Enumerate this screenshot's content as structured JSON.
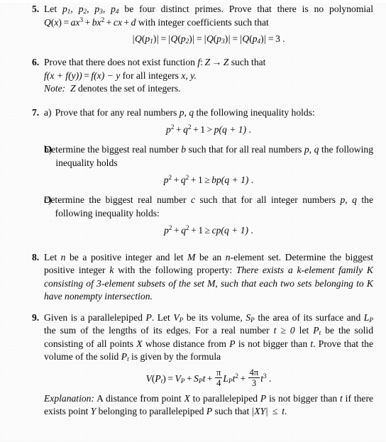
{
  "document": {
    "type": "math-olympiad-problem-sheet",
    "language": "en",
    "problems_shown": [
      "5",
      "6",
      "7",
      "8",
      "9"
    ]
  },
  "problems": [
    {
      "number": "5.",
      "text_before": "Let",
      "statement_part1": " be four distinct primes. Prove that there is no polyno­mial ",
      "statement_part2": " with integer coefficients such that",
      "vars": {
        "p1": "p",
        "p1sub": "1",
        "p2": "p",
        "p2sub": "2",
        "p3": "p",
        "p3sub": "3",
        "p4": "p",
        "p4sub": "4"
      },
      "polynomial": {
        "lhs_fn": "Q",
        "lhs_arg": "x",
        "term1_coef": "a",
        "term1_var": "x",
        "term1_exp": "3",
        "term2_coef": "b",
        "term2_var": "x",
        "term2_exp": "2",
        "term3_coef": "c",
        "term3_var": "x",
        "term4": "d"
      },
      "equation": {
        "value": "3",
        "fn": "Q",
        "args": [
          "p1",
          "p2",
          "p3",
          "p4"
        ]
      }
    },
    {
      "number": "6.",
      "line1": "Prove that there does not exist function ",
      "fn_decl": {
        "name": "f",
        "domain": "Z",
        "codomain": "Z"
      },
      "line1_end": " such that",
      "equation_inline": {
        "lhs": "f(x + f(y))",
        "rhs": "f(x) − y"
      },
      "line2_end": " for all integers ",
      "vars_end": "x, y.",
      "note_label": "Note:",
      "note_text": " denotes the set of integers.",
      "note_symbol": "Z"
    },
    {
      "number": "7.",
      "parts": [
        {
          "label": "a)",
          "text": "Prove that for any real numbers ",
          "vars": "p, q",
          "text_end": " the following inequality holds:",
          "equation": {
            "lhs_terms": [
              "p",
              "q",
              "1"
            ],
            "exponent": "2",
            "relation": ">",
            "rhs": "p(q + 1)",
            "rhs_coef": "",
            "terminator": "."
          }
        },
        {
          "label": "b)",
          "text": "Determine the biggest real number ",
          "var": "b",
          "text_mid": " such that for all real numbers ",
          "vars": "p, q",
          "text_end": " the following inequality holds",
          "equation": {
            "lhs_terms": [
              "p",
              "q",
              "1"
            ],
            "exponent": "2",
            "relation": "≥",
            "rhs_coef": "b",
            "rhs": "p(q + 1)",
            "terminator": "."
          }
        },
        {
          "label": "c)",
          "text": "Determine the biggest real number ",
          "var": "c",
          "text_mid": " such that for all integer numbers ",
          "vars": "p, q",
          "text_end": " the following inequality holds:",
          "equation": {
            "lhs_terms": [
              "p",
              "q",
              "1"
            ],
            "exponent": "2",
            "relation": "≥",
            "rhs_coef": "c",
            "rhs": "p(q + 1)",
            "terminator": "."
          }
        }
      ]
    },
    {
      "number": "8.",
      "text_a": "Let ",
      "var_n": "n",
      "text_b": " be a positive integer and let ",
      "var_M": "M",
      "text_c": " be an ",
      "var_n2": "n",
      "text_d": "-element set. Determine the biggest positive integer ",
      "var_k": "k",
      "text_e": " with the following property: ",
      "italic_property_1": "There exists a ",
      "italic_k": "k",
      "italic_property_2": "-element family ",
      "italic_K": "K",
      "italic_property_3": " consisting of 3-element subsets of the set ",
      "italic_M": "M",
      "italic_property_4": ", such that each two sets belonging to ",
      "italic_K2": "K",
      "italic_property_5": " have nonempty intersection."
    },
    {
      "number": "9.",
      "text_a": "Given is a parallelepiped ",
      "var_P": "P",
      "text_b": ". Let ",
      "var_VP": "V",
      "var_VP_sub": "P",
      "text_c": " be its volume, ",
      "var_SP": "S",
      "var_SP_sub": "P",
      "text_d": " the area of its surface and ",
      "var_LP": "L",
      "var_LP_sub": "P",
      "text_e": " the sum of the lengths of its edges. For a real number ",
      "cond_t": "t ≥ 0",
      "text_f": " let ",
      "var_Pt": "P",
      "var_Pt_sub": "t",
      "text_g": " be the solid consisting of all points ",
      "var_X": "X",
      "text_h": " whose distance from ",
      "var_P2": "P",
      "text_i": " is not bigger than ",
      "var_t": "t",
      "text_j": ". Prove that the volume of the solid ",
      "var_Pt2": "P",
      "var_Pt2_sub": "t",
      "text_k": " is given by the formula",
      "formula": {
        "lhs_fn": "V",
        "lhs_arg": "P",
        "lhs_arg_sub": "t",
        "t1": "V",
        "t1sub": "P",
        "t2": "S",
        "t2sub": "P",
        "t2var": "t",
        "t3_num": "π",
        "t3_den": "4",
        "t3var": "L",
        "t3sub": "P",
        "t3t": "t",
        "t3exp": "2",
        "t4_num": "4π",
        "t4_den": "3",
        "t4t": "t",
        "t4exp": "3",
        "terminator": "."
      },
      "explanation_label": "Explanation:",
      "explanation_a": " A distance from point ",
      "exp_X": "X",
      "explanation_b": " to parallelepiped ",
      "exp_P": "P",
      "explanation_c": " is not bigger than ",
      "exp_t": "t",
      "explanation_d": " if there exists point ",
      "exp_Y": "Y",
      "explanation_e": " belonging to parallelepiped ",
      "exp_P2": "P",
      "explanation_f": " such that ",
      "exp_XY": "XY",
      "explanation_g": " ≤ ",
      "exp_t2": "t",
      "explanation_h": "."
    }
  ],
  "symbols": {
    "arrow": "→",
    "geq": "≥",
    "gt": ">",
    "minus": "−",
    "plus": "+",
    "equals": "=",
    "pi": "π",
    "vbar": "|"
  },
  "colors": {
    "text": "#0a0a0a",
    "background": "#ffffff"
  }
}
